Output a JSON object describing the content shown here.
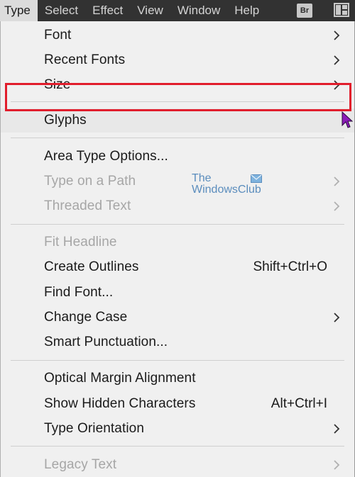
{
  "menubar": {
    "items": [
      {
        "label": "Type",
        "active": true
      },
      {
        "label": "Select",
        "active": false
      },
      {
        "label": "Effect",
        "active": false
      },
      {
        "label": "View",
        "active": false
      },
      {
        "label": "Window",
        "active": false
      },
      {
        "label": "Help",
        "active": false
      }
    ],
    "bridge_icon_text": "Br"
  },
  "menu": {
    "font": {
      "label": "Font"
    },
    "recent_fonts": {
      "label": "Recent Fonts"
    },
    "size": {
      "label": "Size"
    },
    "glyphs": {
      "label": "Glyphs"
    },
    "area_type_options": {
      "label": "Area Type Options..."
    },
    "type_on_a_path": {
      "label": "Type on a Path"
    },
    "threaded_text": {
      "label": "Threaded Text"
    },
    "fit_headline": {
      "label": "Fit Headline"
    },
    "create_outlines": {
      "label": "Create Outlines",
      "shortcut": "Shift+Ctrl+O"
    },
    "find_font": {
      "label": "Find Font..."
    },
    "change_case": {
      "label": "Change Case"
    },
    "smart_punctuation": {
      "label": "Smart Punctuation..."
    },
    "optical_margin_alignment": {
      "label": "Optical Margin Alignment"
    },
    "show_hidden_characters": {
      "label": "Show Hidden Characters",
      "shortcut": "Alt+Ctrl+I"
    },
    "type_orientation": {
      "label": "Type Orientation"
    },
    "legacy_text": {
      "label": "Legacy Text"
    }
  },
  "watermark": {
    "line1": "The",
    "line2": "WindowsClub"
  },
  "colors": {
    "highlight": "#e11d2c",
    "disabled": "#a6a6a6",
    "menubar": "#323232",
    "cursor": "#8b1cb8"
  }
}
